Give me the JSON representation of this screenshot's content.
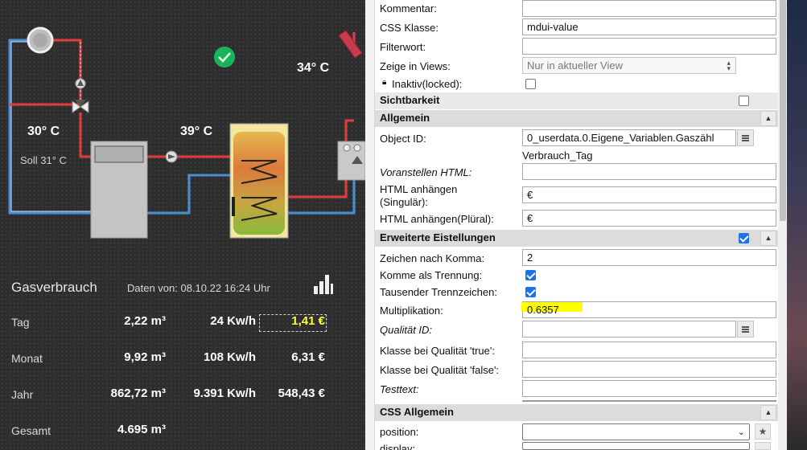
{
  "diagram": {
    "temp_boiler": "34° C",
    "temp_flow": "30° C",
    "soll_label": "Soll 31° C",
    "temp_tank": "39° C"
  },
  "gas": {
    "title": "Gasverbrauch",
    "date_text": "Daten von: 08.10.22 16:24 Uhr",
    "rows": [
      {
        "label": "Tag",
        "m3": "2,22 m³",
        "kwh": "24 Kw/h",
        "eur": "1,41 €"
      },
      {
        "label": "Monat",
        "m3": "9,92 m³",
        "kwh": "108 Kw/h",
        "eur": "6,31 €"
      },
      {
        "label": "Jahr",
        "m3": "862,72 m³",
        "kwh": "9.391 Kw/h",
        "eur": "548,43 €"
      },
      {
        "label": "Gesamt",
        "m3": "4.695 m³",
        "kwh": "",
        "eur": ""
      }
    ]
  },
  "inspector": {
    "kommentar_label": "Kommentar:",
    "css_klasse_label": "CSS Klasse:",
    "css_klasse_value": "mdui-value",
    "filterwort_label": "Filterwort:",
    "views_label": "Zeige in Views:",
    "views_value": "Nur in aktueller View",
    "inaktiv_label": "Inaktiv(locked):",
    "sichtbarkeit": "Sichtbarkeit",
    "allgemein": "Allgemein",
    "object_id_label": "Object ID:",
    "object_id_value": "0_userdata.0.Eigene_Variablen.Gaszähl",
    "object_id_hint": "Verbrauch_Tag",
    "voranstellen_label": "Voranstellen HTML:",
    "anhaengen_sing_label_1": "HTML anhängen",
    "anhaengen_sing_label_2": "(Singulär):",
    "anhaengen_sing_value": "€",
    "anhaengen_plur_label": "HTML anhängen(Plüral):",
    "anhaengen_plur_value": "€",
    "erweiterte": "Erweiterte Eistellungen",
    "komma_label": "Zeichen nach Komma:",
    "komma_value": "2",
    "komma_trennung_label": "Komme als Trennung:",
    "tausender_label": "Tausender Trennzeichen:",
    "multiplikation_label": "Multiplikation:",
    "multiplikation_value": "0.6357",
    "qualitaet_id_label": "Qualität ID:",
    "klasse_true_label": "Klasse bei Qualität 'true':",
    "klasse_false_label": "Klasse bei Qualität 'false':",
    "testtext_label": "Testtext:",
    "css_allgemein": "CSS Allgemein",
    "position_label": "position:",
    "display_label": "display:"
  },
  "colors": {
    "highlight_text": "#ffff3a",
    "checkbox_accent": "#1a73e8",
    "section_bg": "#dcdcdc",
    "hot_pipe": "#e23b3b",
    "cold_pipe": "#4a8fd6",
    "status_ok": "#19b35a"
  },
  "icons": [
    "check-circle-icon",
    "bar-chart-icon",
    "lock-icon",
    "chevron-up-icon",
    "chevron-down-icon",
    "star-icon",
    "list-picker-icon",
    "pump-icon",
    "valve-icon"
  ]
}
